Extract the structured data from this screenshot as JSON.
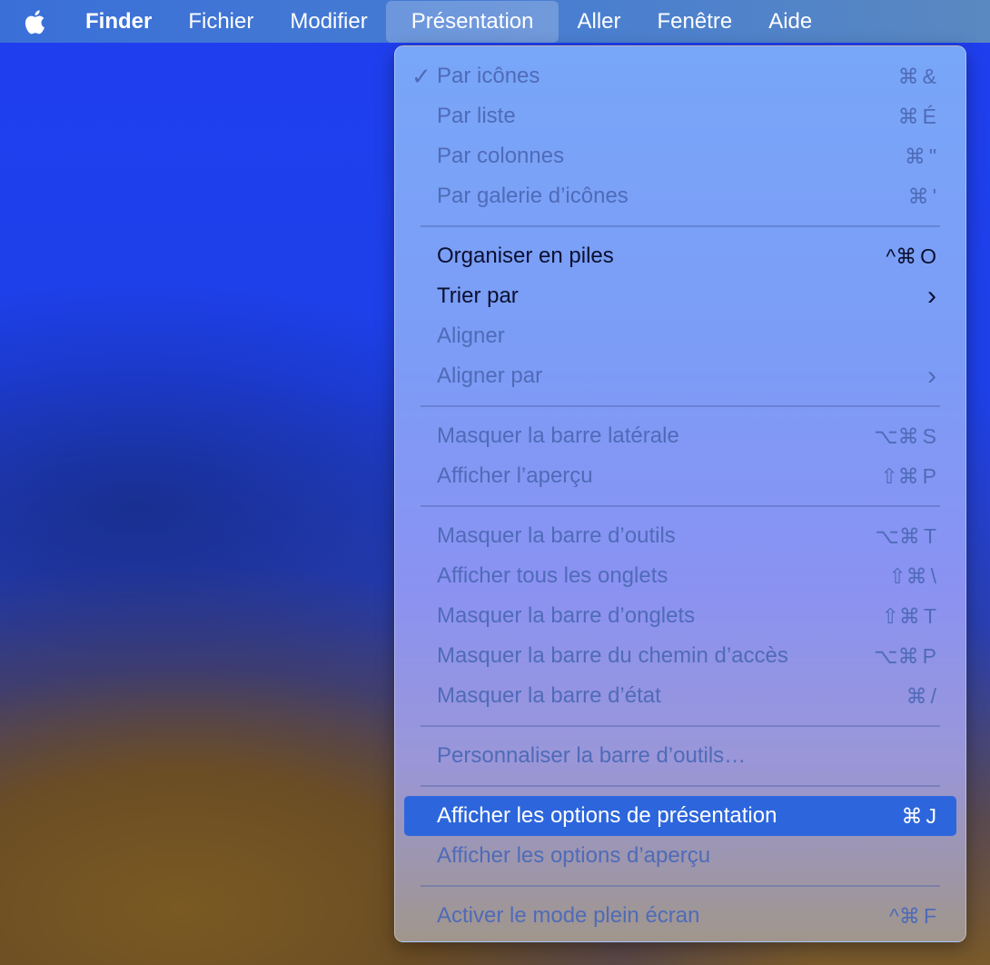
{
  "menubar": {
    "apple": "",
    "items": [
      "Finder",
      "Fichier",
      "Modifier",
      "Présentation",
      "Aller",
      "Fenêtre",
      "Aide"
    ]
  },
  "menu": {
    "groups": [
      [
        {
          "label": "Par icônes",
          "checked": "✓",
          "mods": "⌘",
          "key": "&"
        },
        {
          "label": "Par liste",
          "mods": "⌘",
          "key": "É"
        },
        {
          "label": "Par colonnes",
          "mods": "⌘",
          "key": "\""
        },
        {
          "label": "Par galerie d’icônes",
          "mods": "⌘",
          "key": "'"
        }
      ],
      [
        {
          "label": "Organiser en piles",
          "mods": "^⌘",
          "key": "O",
          "enabled": true
        },
        {
          "label": "Trier par",
          "key": "›",
          "enabled": true
        },
        {
          "label": "Aligner"
        },
        {
          "label": "Aligner par",
          "key": "›"
        }
      ],
      [
        {
          "label": "Masquer la barre latérale",
          "mods": "⌥⌘",
          "key": "S"
        },
        {
          "label": "Afficher l’aperçu",
          "mods": "⇧⌘",
          "key": "P"
        }
      ],
      [
        {
          "label": "Masquer la barre d’outils",
          "mods": "⌥⌘",
          "key": "T"
        },
        {
          "label": "Afficher tous les onglets",
          "mods": "⇧⌘",
          "key": "\\"
        },
        {
          "label": "Masquer la barre d’onglets",
          "mods": "⇧⌘",
          "key": "T"
        },
        {
          "label": "Masquer la barre du chemin d’accès",
          "mods": "⌥⌘",
          "key": "P"
        },
        {
          "label": "Masquer la barre d’état",
          "mods": "⌘",
          "key": "/"
        }
      ],
      [
        {
          "label": "Personnaliser la barre d’outils…"
        }
      ],
      [
        {
          "label": "Afficher les options de présentation",
          "mods": "⌘",
          "key": "J",
          "enabled": true,
          "highlighted": true
        },
        {
          "label": "Afficher les options d’aperçu"
        }
      ],
      [
        {
          "label": "Activer le mode plein écran",
          "mods": "^⌘",
          "key": "F"
        }
      ]
    ]
  }
}
